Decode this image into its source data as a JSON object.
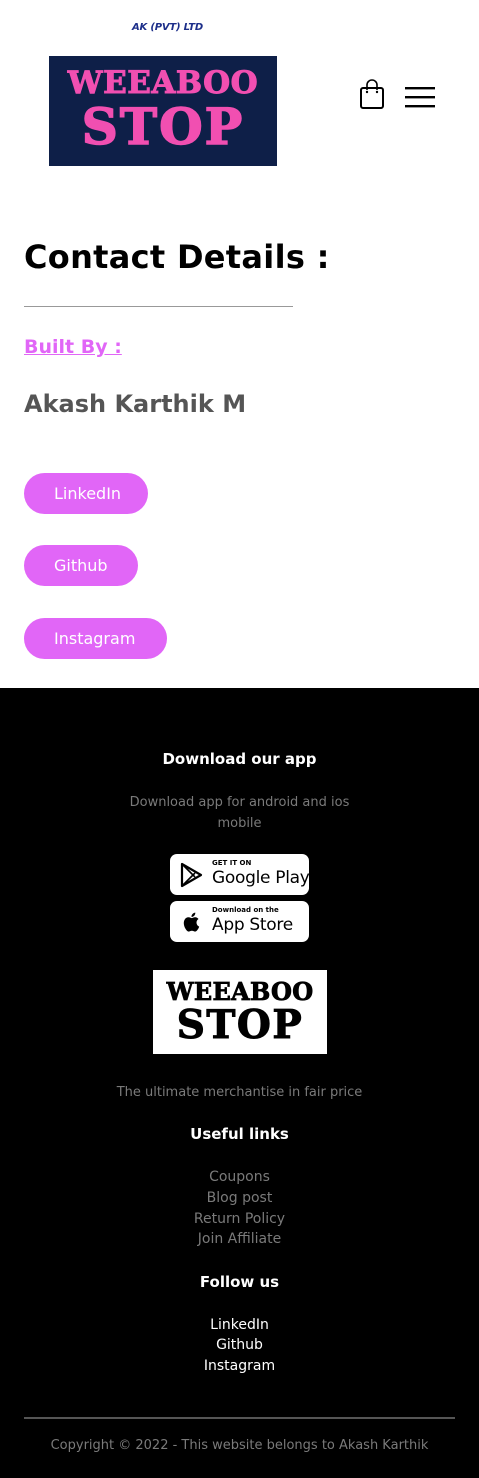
{
  "header": {
    "company": "AK (PVT) LTD",
    "logo_line1": "WEEABOO",
    "logo_line2": "STOP",
    "cart_icon": "shopping-bag-icon",
    "menu_icon": "hamburger-menu-icon"
  },
  "contact": {
    "title": "Contact Details :",
    "built_by_label": "Built By :",
    "name": "Akash Karthik M",
    "buttons": [
      {
        "label": "LinkedIn"
      },
      {
        "label": "Github"
      },
      {
        "label": "Instagram"
      }
    ]
  },
  "footer": {
    "download_heading": "Download our app",
    "download_text": "Download app for android and ios mobile",
    "google_play": {
      "small": "GET IT ON",
      "big": "Google Play",
      "icon": "google-play-icon"
    },
    "app_store": {
      "small": "Download on the",
      "big": "App Store",
      "icon": "apple-icon"
    },
    "logo_line1": "WEEABOO",
    "logo_line2": "STOP",
    "tagline": "The ultimate merchantise in fair price",
    "useful_heading": "Useful links",
    "useful_links": [
      {
        "label": "Coupons"
      },
      {
        "label": "Blog post"
      },
      {
        "label": "Return Policy"
      },
      {
        "label": "Join Affiliate"
      }
    ],
    "follow_heading": "Follow us",
    "follow_links": [
      {
        "label": "LinkedIn"
      },
      {
        "label": "Github"
      },
      {
        "label": "Instagram"
      }
    ],
    "copyright": "Copyright © 2022 - This website belongs to Akash Karthik"
  },
  "colors": {
    "accent": "#e166f7",
    "logo_pink": "#f14fb1",
    "logo_navy": "#0e1f48",
    "footer_bg": "#000000",
    "muted_text": "#7a7a7a"
  }
}
